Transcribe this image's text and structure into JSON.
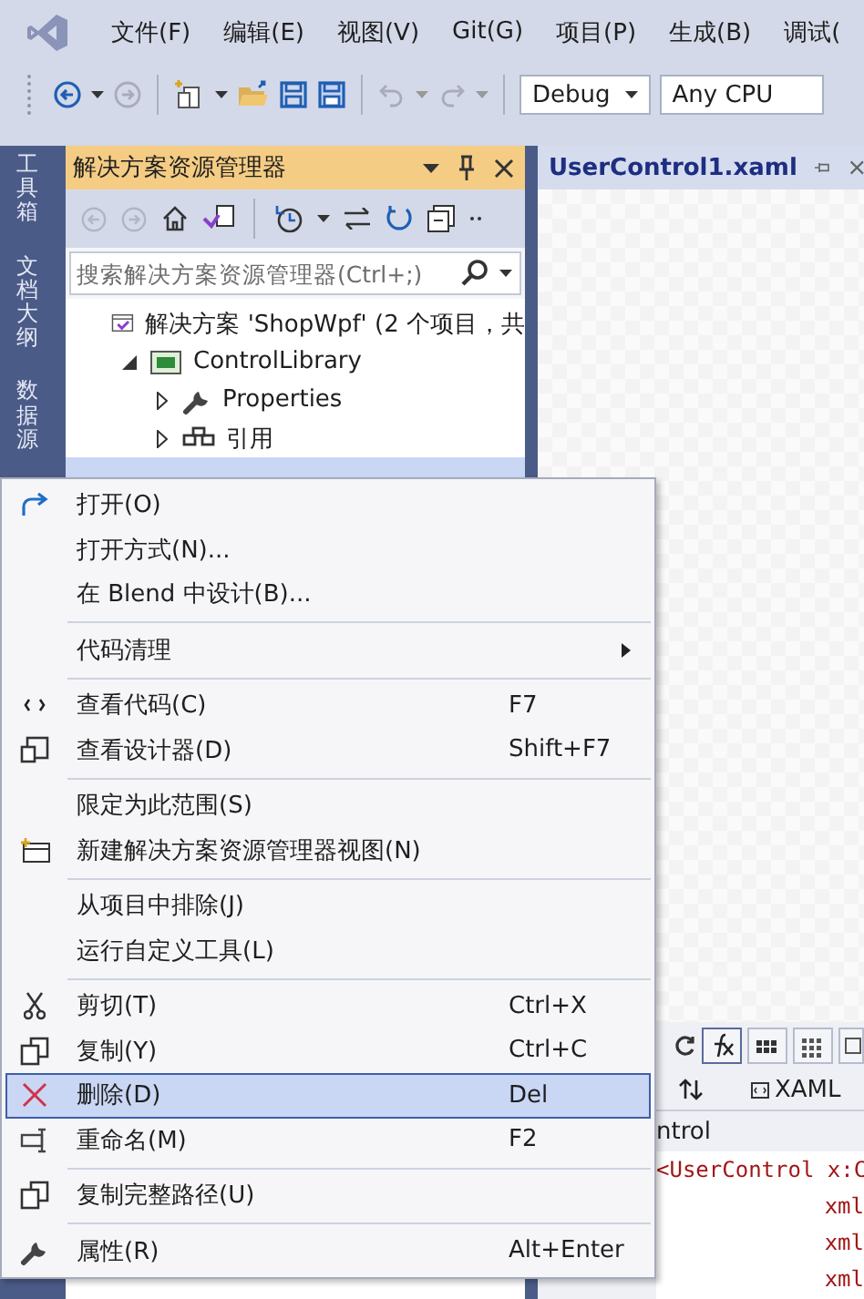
{
  "menu_bar": {
    "items": [
      "文件(F)",
      "编辑(E)",
      "视图(V)",
      "Git(G)",
      "项目(P)",
      "生成(B)",
      "调试("
    ]
  },
  "toolbar": {
    "configuration": "Debug",
    "platform": "Any CPU"
  },
  "side_tabs": [
    "工具箱",
    "文档大纲",
    "数据源"
  ],
  "solution_explorer": {
    "title": "解决方案资源管理器",
    "search": {
      "placeholder": "搜索解决方案资源管理器(Ctrl+;)"
    },
    "tree": [
      {
        "kind": "solution",
        "label": "解决方案 'ShopWpf' (2 个项目，共",
        "children": [
          {
            "kind": "project",
            "label": "ControlLibrary",
            "expanded": true,
            "children": [
              {
                "kind": "properties",
                "label": "Properties",
                "expanded": false
              },
              {
                "kind": "references",
                "label": "引用",
                "expanded": false
              }
            ]
          }
        ]
      }
    ]
  },
  "document": {
    "tab": "UserControl1.xaml",
    "view_label": "XAML",
    "breadcrumb": "ntrol",
    "code_lines": [
      "<UserControl x:C",
      "xml",
      "xml",
      "xml"
    ]
  },
  "context_menu": [
    {
      "kind": "item",
      "label": "打开(O)",
      "submenu": false,
      "selected": false
    },
    {
      "kind": "item",
      "label": "打开方式(N)...",
      "submenu": false,
      "selected": false
    },
    {
      "kind": "item",
      "label": "在 Blend 中设计(B)...",
      "submenu": false,
      "selected": false
    },
    {
      "kind": "separator"
    },
    {
      "kind": "item",
      "label": "代码清理",
      "submenu": true,
      "selected": false
    },
    {
      "kind": "separator"
    },
    {
      "kind": "item",
      "label": "查看代码(C)",
      "shortcut": "F7",
      "submenu": false,
      "selected": false
    },
    {
      "kind": "item",
      "label": "查看设计器(D)",
      "shortcut": "Shift+F7",
      "submenu": false,
      "selected": false
    },
    {
      "kind": "separator"
    },
    {
      "kind": "item",
      "label": "限定为此范围(S)",
      "submenu": false,
      "selected": false
    },
    {
      "kind": "item",
      "label": "新建解决方案资源管理器视图(N)",
      "submenu": false,
      "selected": false
    },
    {
      "kind": "separator"
    },
    {
      "kind": "item",
      "label": "从项目中排除(J)",
      "submenu": false,
      "selected": false
    },
    {
      "kind": "item",
      "label": "运行自定义工具(L)",
      "submenu": false,
      "selected": false
    },
    {
      "kind": "separator"
    },
    {
      "kind": "item",
      "label": "剪切(T)",
      "shortcut": "Ctrl+X",
      "submenu": false,
      "selected": false
    },
    {
      "kind": "item",
      "label": "复制(Y)",
      "shortcut": "Ctrl+C",
      "submenu": false,
      "selected": false
    },
    {
      "kind": "item",
      "label": "删除(D)",
      "shortcut": "Del",
      "submenu": false,
      "selected": true
    },
    {
      "kind": "item",
      "label": "重命名(M)",
      "shortcut": "F2",
      "submenu": false,
      "selected": false
    },
    {
      "kind": "separator"
    },
    {
      "kind": "item",
      "label": "复制完整路径(U)",
      "submenu": false,
      "selected": false
    },
    {
      "kind": "separator"
    },
    {
      "kind": "item",
      "label": "属性(R)",
      "shortcut": "Alt+Enter",
      "submenu": false,
      "selected": false
    }
  ]
}
